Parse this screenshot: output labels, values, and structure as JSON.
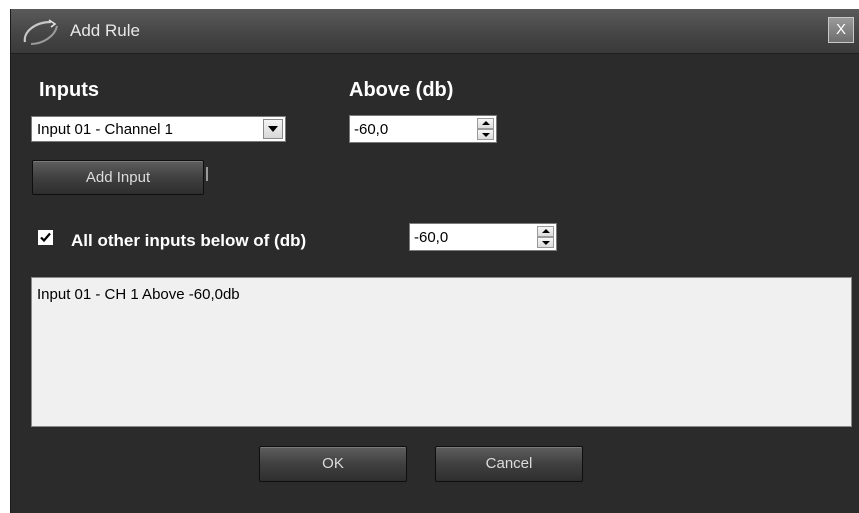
{
  "window": {
    "title": "Add Rule",
    "close_label": "X"
  },
  "inputs": {
    "label": "Inputs",
    "selected": "Input 01 - Channel 1",
    "add_button": "Add Input"
  },
  "above": {
    "label": "Above (db)",
    "value": "-60,0"
  },
  "below": {
    "checked": true,
    "label": "All other inputs below of (db)",
    "value": "-60,0"
  },
  "rules": {
    "items": [
      "Input 01 - CH 1 Above -60,0db"
    ]
  },
  "footer": {
    "ok_label": "OK",
    "cancel_label": "Cancel"
  },
  "colors": {
    "background": "#2b2b2b",
    "titlebar": "#4a4a4a",
    "list_background": "#f0f0f0",
    "text": "#ffffff"
  }
}
